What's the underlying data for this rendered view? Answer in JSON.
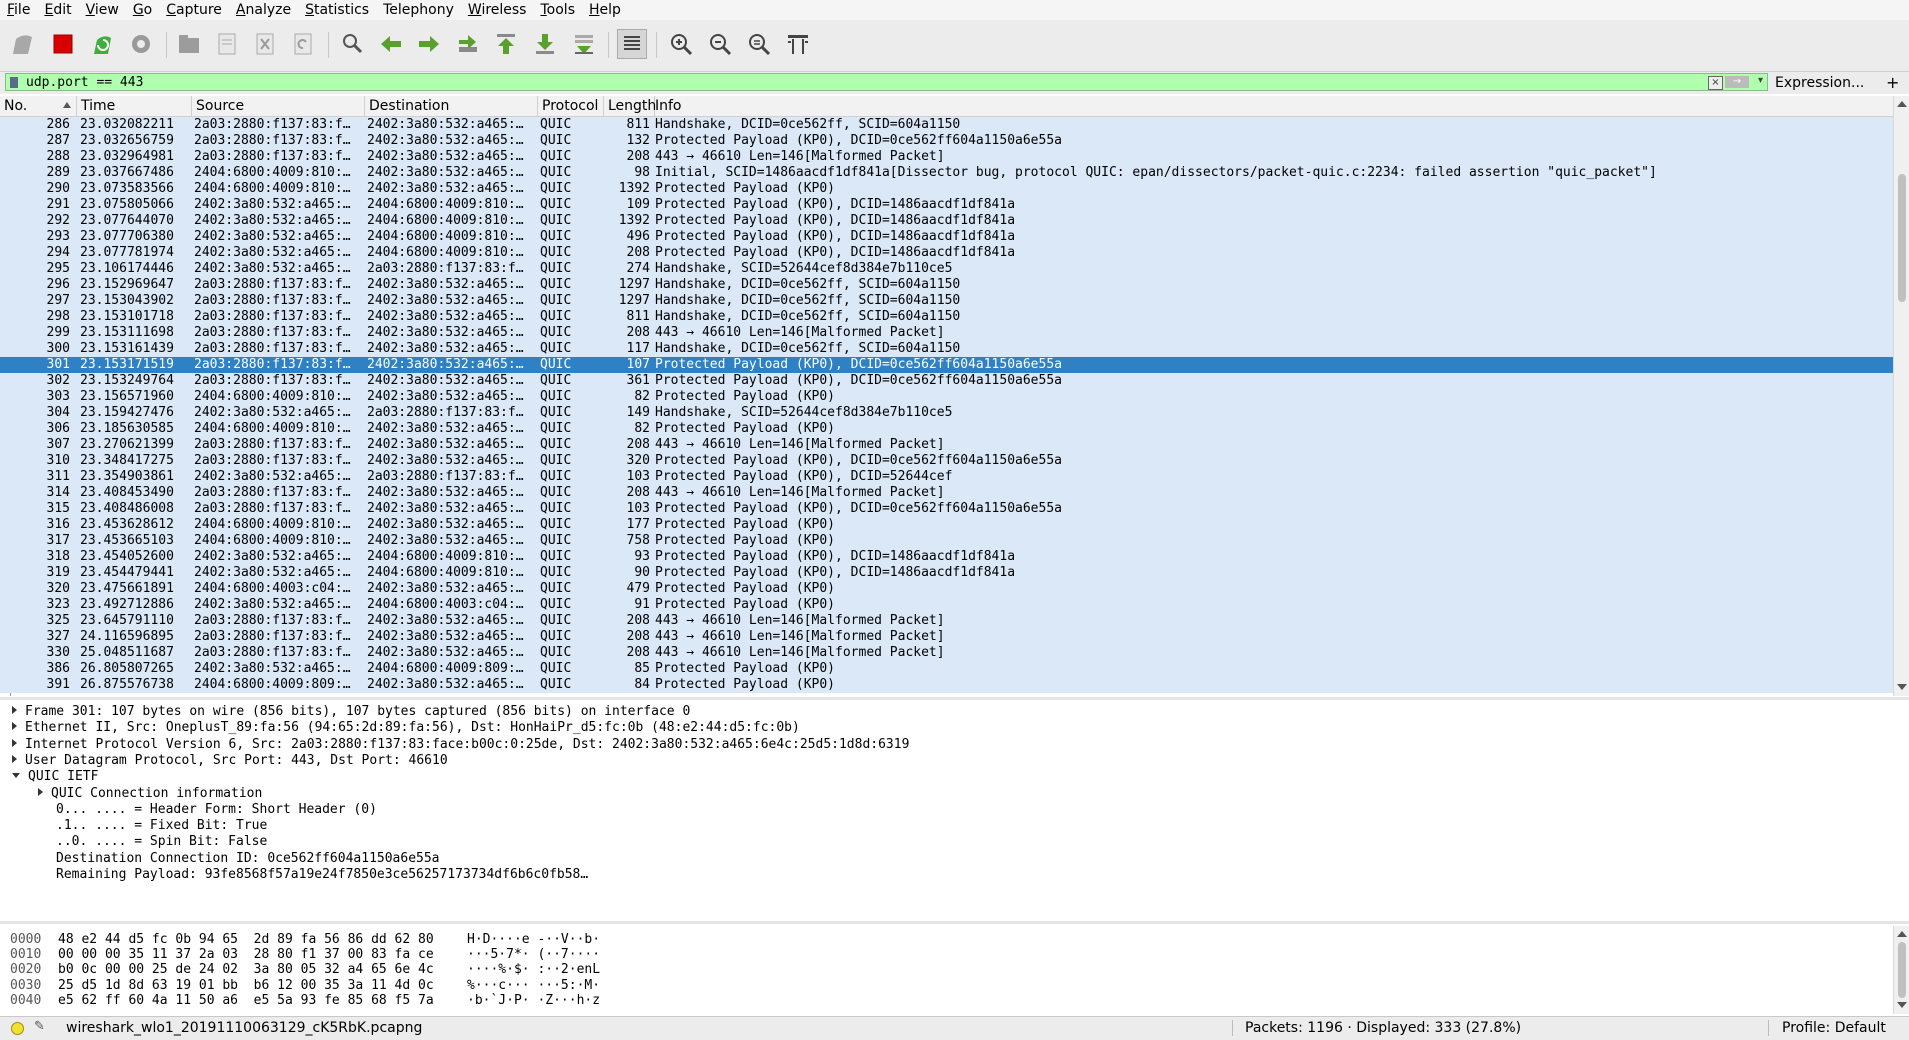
{
  "menubar": {
    "items": [
      {
        "underline": "F",
        "rest": "ile"
      },
      {
        "underline": "E",
        "rest": "dit"
      },
      {
        "underline": "V",
        "rest": "iew"
      },
      {
        "underline": "G",
        "rest": "o"
      },
      {
        "underline": "C",
        "rest": "apture"
      },
      {
        "underline": "A",
        "rest": "nalyze"
      },
      {
        "underline": "S",
        "rest": "tatistics"
      },
      {
        "underline": "",
        "rest": "Telephony"
      },
      {
        "underline": "W",
        "rest": "ireless"
      },
      {
        "underline": "T",
        "rest": "ools"
      },
      {
        "underline": "H",
        "rest": "elp"
      }
    ]
  },
  "toolbar": {
    "icons": [
      "shark-fin-start-icon",
      "stop-capture-icon",
      "restart-capture-icon",
      "capture-options-icon",
      "open-file-icon",
      "save-file-icon",
      "close-file-icon",
      "reload-file-icon",
      "find-packet-icon",
      "go-back-icon",
      "go-forward-icon",
      "go-to-packet-icon",
      "first-packet-icon",
      "last-packet-icon",
      "auto-scroll-icon",
      "colorize-icon",
      "zoom-in-icon",
      "zoom-out-icon",
      "normal-size-icon",
      "resize-columns-icon"
    ]
  },
  "filter": {
    "value": "udp.port == 443",
    "expression_label": "Expression...",
    "add_label": "+"
  },
  "columns": {
    "no": "No.",
    "time": "Time",
    "source": "Source",
    "destination": "Destination",
    "protocol": "Protocol",
    "length": "Length",
    "info": "Info"
  },
  "packets": [
    {
      "no": "286",
      "time": "23.032082211",
      "src": "2a03:2880:f137:83:f…",
      "dst": "2402:3a80:532:a465:…",
      "proto": "QUIC",
      "len": "811",
      "info": "Handshake, DCID=0ce562ff, SCID=604a1150"
    },
    {
      "no": "287",
      "time": "23.032656759",
      "src": "2a03:2880:f137:83:f…",
      "dst": "2402:3a80:532:a465:…",
      "proto": "QUIC",
      "len": "132",
      "info": "Protected Payload (KP0), DCID=0ce562ff604a1150a6e55a"
    },
    {
      "no": "288",
      "time": "23.032964981",
      "src": "2a03:2880:f137:83:f…",
      "dst": "2402:3a80:532:a465:…",
      "proto": "QUIC",
      "len": "208",
      "info": "443 → 46610 Len=146[Malformed Packet]"
    },
    {
      "no": "289",
      "time": "23.037667486",
      "src": "2404:6800:4009:810:…",
      "dst": "2402:3a80:532:a465:…",
      "proto": "QUIC",
      "len": "98",
      "info": "Initial, SCID=1486aacdf1df841a[Dissector bug, protocol QUIC: epan/dissectors/packet-quic.c:2234: failed assertion \"quic_packet\"]"
    },
    {
      "no": "290",
      "time": "23.073583566",
      "src": "2404:6800:4009:810:…",
      "dst": "2402:3a80:532:a465:…",
      "proto": "QUIC",
      "len": "1392",
      "info": "Protected Payload (KP0)"
    },
    {
      "no": "291",
      "time": "23.075805066",
      "src": "2402:3a80:532:a465:…",
      "dst": "2404:6800:4009:810:…",
      "proto": "QUIC",
      "len": "109",
      "info": "Protected Payload (KP0), DCID=1486aacdf1df841a"
    },
    {
      "no": "292",
      "time": "23.077644070",
      "src": "2402:3a80:532:a465:…",
      "dst": "2404:6800:4009:810:…",
      "proto": "QUIC",
      "len": "1392",
      "info": "Protected Payload (KP0), DCID=1486aacdf1df841a"
    },
    {
      "no": "293",
      "time": "23.077706380",
      "src": "2402:3a80:532:a465:…",
      "dst": "2404:6800:4009:810:…",
      "proto": "QUIC",
      "len": "496",
      "info": "Protected Payload (KP0), DCID=1486aacdf1df841a"
    },
    {
      "no": "294",
      "time": "23.077781974",
      "src": "2402:3a80:532:a465:…",
      "dst": "2404:6800:4009:810:…",
      "proto": "QUIC",
      "len": "208",
      "info": "Protected Payload (KP0), DCID=1486aacdf1df841a"
    },
    {
      "no": "295",
      "time": "23.106174446",
      "src": "2402:3a80:532:a465:…",
      "dst": "2a03:2880:f137:83:f…",
      "proto": "QUIC",
      "len": "274",
      "info": "Handshake, SCID=52644cef8d384e7b110ce5"
    },
    {
      "no": "296",
      "time": "23.152969647",
      "src": "2a03:2880:f137:83:f…",
      "dst": "2402:3a80:532:a465:…",
      "proto": "QUIC",
      "len": "1297",
      "info": "Handshake, DCID=0ce562ff, SCID=604a1150"
    },
    {
      "no": "297",
      "time": "23.153043902",
      "src": "2a03:2880:f137:83:f…",
      "dst": "2402:3a80:532:a465:…",
      "proto": "QUIC",
      "len": "1297",
      "info": "Handshake, DCID=0ce562ff, SCID=604a1150"
    },
    {
      "no": "298",
      "time": "23.153101718",
      "src": "2a03:2880:f137:83:f…",
      "dst": "2402:3a80:532:a465:…",
      "proto": "QUIC",
      "len": "811",
      "info": "Handshake, DCID=0ce562ff, SCID=604a1150"
    },
    {
      "no": "299",
      "time": "23.153111698",
      "src": "2a03:2880:f137:83:f…",
      "dst": "2402:3a80:532:a465:…",
      "proto": "QUIC",
      "len": "208",
      "info": "443 → 46610 Len=146[Malformed Packet]"
    },
    {
      "no": "300",
      "time": "23.153161439",
      "src": "2a03:2880:f137:83:f…",
      "dst": "2402:3a80:532:a465:…",
      "proto": "QUIC",
      "len": "117",
      "info": "Handshake, DCID=0ce562ff, SCID=604a1150"
    },
    {
      "no": "301",
      "time": "23.153171519",
      "src": "2a03:2880:f137:83:f…",
      "dst": "2402:3a80:532:a465:…",
      "proto": "QUIC",
      "len": "107",
      "info": "Protected Payload (KP0), DCID=0ce562ff604a1150a6e55a",
      "selected": true
    },
    {
      "no": "302",
      "time": "23.153249764",
      "src": "2a03:2880:f137:83:f…",
      "dst": "2402:3a80:532:a465:…",
      "proto": "QUIC",
      "len": "361",
      "info": "Protected Payload (KP0), DCID=0ce562ff604a1150a6e55a"
    },
    {
      "no": "303",
      "time": "23.156571960",
      "src": "2404:6800:4009:810:…",
      "dst": "2402:3a80:532:a465:…",
      "proto": "QUIC",
      "len": "82",
      "info": "Protected Payload (KP0)"
    },
    {
      "no": "304",
      "time": "23.159427476",
      "src": "2402:3a80:532:a465:…",
      "dst": "2a03:2880:f137:83:f…",
      "proto": "QUIC",
      "len": "149",
      "info": "Handshake, SCID=52644cef8d384e7b110ce5"
    },
    {
      "no": "306",
      "time": "23.185630585",
      "src": "2404:6800:4009:810:…",
      "dst": "2402:3a80:532:a465:…",
      "proto": "QUIC",
      "len": "82",
      "info": "Protected Payload (KP0)"
    },
    {
      "no": "307",
      "time": "23.270621399",
      "src": "2a03:2880:f137:83:f…",
      "dst": "2402:3a80:532:a465:…",
      "proto": "QUIC",
      "len": "208",
      "info": "443 → 46610 Len=146[Malformed Packet]"
    },
    {
      "no": "310",
      "time": "23.348417275",
      "src": "2a03:2880:f137:83:f…",
      "dst": "2402:3a80:532:a465:…",
      "proto": "QUIC",
      "len": "320",
      "info": "Protected Payload (KP0), DCID=0ce562ff604a1150a6e55a"
    },
    {
      "no": "311",
      "time": "23.354903861",
      "src": "2402:3a80:532:a465:…",
      "dst": "2a03:2880:f137:83:f…",
      "proto": "QUIC",
      "len": "103",
      "info": "Protected Payload (KP0), DCID=52644cef"
    },
    {
      "no": "314",
      "time": "23.408453490",
      "src": "2a03:2880:f137:83:f…",
      "dst": "2402:3a80:532:a465:…",
      "proto": "QUIC",
      "len": "208",
      "info": "443 → 46610 Len=146[Malformed Packet]"
    },
    {
      "no": "315",
      "time": "23.408486008",
      "src": "2a03:2880:f137:83:f…",
      "dst": "2402:3a80:532:a465:…",
      "proto": "QUIC",
      "len": "103",
      "info": "Protected Payload (KP0), DCID=0ce562ff604a1150a6e55a"
    },
    {
      "no": "316",
      "time": "23.453628612",
      "src": "2404:6800:4009:810:…",
      "dst": "2402:3a80:532:a465:…",
      "proto": "QUIC",
      "len": "177",
      "info": "Protected Payload (KP0)"
    },
    {
      "no": "317",
      "time": "23.453665103",
      "src": "2404:6800:4009:810:…",
      "dst": "2402:3a80:532:a465:…",
      "proto": "QUIC",
      "len": "758",
      "info": "Protected Payload (KP0)"
    },
    {
      "no": "318",
      "time": "23.454052600",
      "src": "2402:3a80:532:a465:…",
      "dst": "2404:6800:4009:810:…",
      "proto": "QUIC",
      "len": "93",
      "info": "Protected Payload (KP0), DCID=1486aacdf1df841a"
    },
    {
      "no": "319",
      "time": "23.454479441",
      "src": "2402:3a80:532:a465:…",
      "dst": "2404:6800:4009:810:…",
      "proto": "QUIC",
      "len": "90",
      "info": "Protected Payload (KP0), DCID=1486aacdf1df841a"
    },
    {
      "no": "320",
      "time": "23.475661891",
      "src": "2404:6800:4003:c04:…",
      "dst": "2402:3a80:532:a465:…",
      "proto": "QUIC",
      "len": "479",
      "info": "Protected Payload (KP0)"
    },
    {
      "no": "323",
      "time": "23.492712886",
      "src": "2402:3a80:532:a465:…",
      "dst": "2404:6800:4003:c04:…",
      "proto": "QUIC",
      "len": "91",
      "info": "Protected Payload (KP0)"
    },
    {
      "no": "325",
      "time": "23.645791110",
      "src": "2a03:2880:f137:83:f…",
      "dst": "2402:3a80:532:a465:…",
      "proto": "QUIC",
      "len": "208",
      "info": "443 → 46610 Len=146[Malformed Packet]"
    },
    {
      "no": "327",
      "time": "24.116596895",
      "src": "2a03:2880:f137:83:f…",
      "dst": "2402:3a80:532:a465:…",
      "proto": "QUIC",
      "len": "208",
      "info": "443 → 46610 Len=146[Malformed Packet]"
    },
    {
      "no": "330",
      "time": "25.048511687",
      "src": "2a03:2880:f137:83:f…",
      "dst": "2402:3a80:532:a465:…",
      "proto": "QUIC",
      "len": "208",
      "info": "443 → 46610 Len=146[Malformed Packet]"
    },
    {
      "no": "386",
      "time": "26.805807265",
      "src": "2402:3a80:532:a465:…",
      "dst": "2404:6800:4009:809:…",
      "proto": "QUIC",
      "len": "85",
      "info": "Protected Payload (KP0)"
    },
    {
      "no": "391",
      "time": "26.875576738",
      "src": "2404:6800:4009:809:…",
      "dst": "2402:3a80:532:a465:…",
      "proto": "QUIC",
      "len": "84",
      "info": "Protected Payload (KP0)"
    }
  ],
  "details": [
    {
      "level": 0,
      "toggle": "collapsed",
      "text": "Frame 301: 107 bytes on wire (856 bits), 107 bytes captured (856 bits) on interface 0"
    },
    {
      "level": 0,
      "toggle": "collapsed",
      "text": "Ethernet II, Src: OneplusT_89:fa:56 (94:65:2d:89:fa:56), Dst: HonHaiPr_d5:fc:0b (48:e2:44:d5:fc:0b)"
    },
    {
      "level": 0,
      "toggle": "collapsed",
      "text": "Internet Protocol Version 6, Src: 2a03:2880:f137:83:face:b00c:0:25de, Dst: 2402:3a80:532:a465:6e4c:25d5:1d8d:6319"
    },
    {
      "level": 0,
      "toggle": "collapsed",
      "text": "User Datagram Protocol, Src Port: 443, Dst Port: 46610"
    },
    {
      "level": 0,
      "toggle": "expanded",
      "text": "QUIC IETF"
    },
    {
      "level": 1,
      "toggle": "collapsed",
      "text": "QUIC Connection information"
    },
    {
      "level": 1,
      "toggle": "none",
      "text": "0... .... = Header Form: Short Header (0)"
    },
    {
      "level": 1,
      "toggle": "none",
      "text": ".1.. .... = Fixed Bit: True"
    },
    {
      "level": 1,
      "toggle": "none",
      "text": "..0. .... = Spin Bit: False"
    },
    {
      "level": 1,
      "toggle": "none",
      "text": "Destination Connection ID: 0ce562ff604a1150a6e55a"
    },
    {
      "level": 1,
      "toggle": "none",
      "text": "Remaining Payload: 93fe8568f57a19e24f7850e3ce56257173734df6b6c0fb58…"
    }
  ],
  "bytes": [
    {
      "offset": "0000",
      "hex": "48 e2 44 d5 fc 0b 94 65  2d 89 fa 56 86 dd 62 80",
      "ascii": "H·D····e -··V··b·"
    },
    {
      "offset": "0010",
      "hex": "00 00 00 35 11 37 2a 03  28 80 f1 37 00 83 fa ce",
      "ascii": "···5·7*· (··7····"
    },
    {
      "offset": "0020",
      "hex": "b0 0c 00 00 25 de 24 02  3a 80 05 32 a4 65 6e 4c",
      "ascii": "····%·$· :··2·enL"
    },
    {
      "offset": "0030",
      "hex": "25 d5 1d 8d 63 19 01 bb  b6 12 00 35 3a 11 4d 0c",
      "ascii": "%···c··· ···5:·M·"
    },
    {
      "offset": "0040",
      "hex": "e5 62 ff 60 4a 11 50 a6  e5 5a 93 fe 85 68 f5 7a",
      "ascii": "·b·`J·P· ·Z···h·z"
    }
  ],
  "status": {
    "file": "wireshark_wlo1_20191110063129_cK5RbK.pcapng",
    "packets": "Packets: 1196 · Displayed: 333 (27.8%)",
    "profile": "Profile: Default"
  }
}
